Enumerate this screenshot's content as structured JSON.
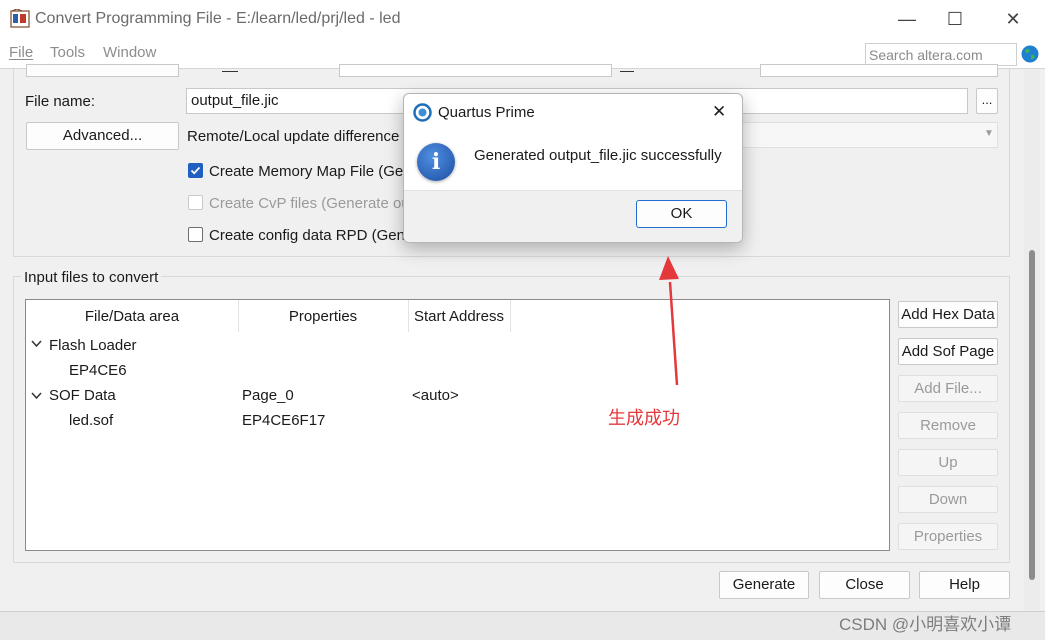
{
  "window": {
    "title": "Convert Programming File - E:/learn/led/prj/led - led",
    "controls": {
      "minimize": "—",
      "maximize": "☐",
      "close": "✕"
    }
  },
  "menu": {
    "items": [
      {
        "label": "File",
        "accel": "F"
      },
      {
        "label": "Tools",
        "accel": "T"
      },
      {
        "label": "Window",
        "accel": "W"
      }
    ],
    "search_placeholder": "Search altera.com"
  },
  "output": {
    "file_name_label": "File name:",
    "file_name_value": "output_file.jic",
    "browse_label": "...",
    "advanced_label": "Advanced...",
    "remote_local_label": "Remote/Local update difference",
    "create_memory_map_label": "Create Memory Map File (Ge",
    "create_cvp_label": "Create CvP files (Generate ou",
    "create_rpd_label": "Create config data RPD (Gene",
    "create_memory_map_checked": true,
    "create_cvp_checked": false,
    "create_rpd_checked": false
  },
  "input_files": {
    "legend": "Input files to convert",
    "columns": [
      "File/Data area",
      "Properties",
      "Start Address"
    ],
    "rows": [
      {
        "name": "Flash Loader",
        "properties": "",
        "start": "",
        "level": 0,
        "expanded": true
      },
      {
        "name": "EP4CE6",
        "properties": "",
        "start": "",
        "level": 1
      },
      {
        "name": "SOF Data",
        "properties": "Page_0",
        "start": "<auto>",
        "level": 0,
        "expanded": true
      },
      {
        "name": "led.sof",
        "properties": "EP4CE6F17",
        "start": "",
        "level": 1
      }
    ],
    "side_buttons": [
      {
        "label": "Add Hex Data",
        "enabled": true
      },
      {
        "label": "Add Sof Page",
        "enabled": true
      },
      {
        "label": "Add File...",
        "enabled": false
      },
      {
        "label": "Remove",
        "enabled": false
      },
      {
        "label": "Up",
        "enabled": false
      },
      {
        "label": "Down",
        "enabled": false
      },
      {
        "label": "Properties",
        "enabled": false
      }
    ]
  },
  "footer_buttons": {
    "generate": "Generate",
    "close": "Close",
    "help": "Help"
  },
  "dialog": {
    "title": "Quartus Prime",
    "message": "Generated output_file.jic successfully",
    "ok_label": "OK",
    "close_glyph": "✕",
    "info_glyph": "i"
  },
  "annotation": {
    "text": "生成成功",
    "color": "#e5383b"
  },
  "watermark": "CSDN @小明喜欢小谭"
}
